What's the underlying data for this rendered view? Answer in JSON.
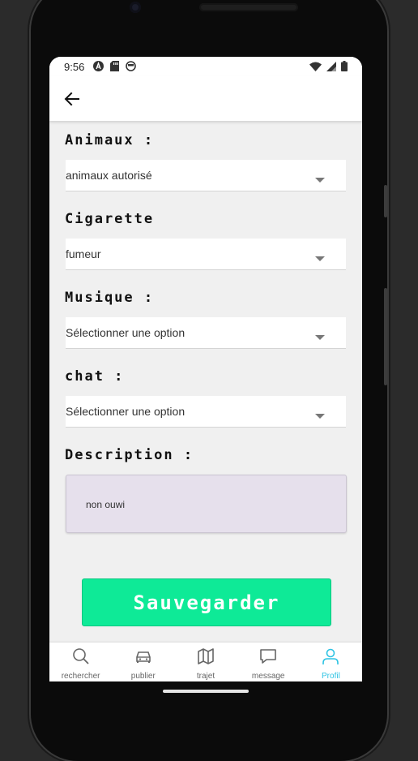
{
  "status_bar": {
    "time": "9:56",
    "left_icons": [
      "a-circle-icon",
      "sd-card-icon",
      "face-icon"
    ],
    "right_icons": [
      "wifi-icon",
      "signal-icon",
      "battery-icon"
    ]
  },
  "app_bar": {
    "back_icon": "arrow-left-icon"
  },
  "form": {
    "animaux": {
      "label": "Animaux :",
      "value": "animaux autorisé"
    },
    "cigarette": {
      "label": "Cigarette",
      "value": "fumeur"
    },
    "musique": {
      "label": "Musique :",
      "value": "Sélectionner une option"
    },
    "chat": {
      "label": "chat :",
      "value": "Sélectionner une option"
    },
    "description": {
      "label": "Description :",
      "value": "non ouwi"
    },
    "save_label": "Sauvegarder"
  },
  "bottom_nav": {
    "items": [
      {
        "label": "rechercher",
        "icon": "search-icon"
      },
      {
        "label": "publier",
        "icon": "car-icon"
      },
      {
        "label": "trajet",
        "icon": "map-icon"
      },
      {
        "label": "message",
        "icon": "chat-bubble-icon"
      },
      {
        "label": "Profil",
        "icon": "person-icon",
        "active": true
      }
    ]
  },
  "colors": {
    "accent_button": "#0eea97",
    "active_nav": "#2ec3e3",
    "description_bg": "#e6e0ec",
    "screen_bg": "#f0f0f0"
  }
}
